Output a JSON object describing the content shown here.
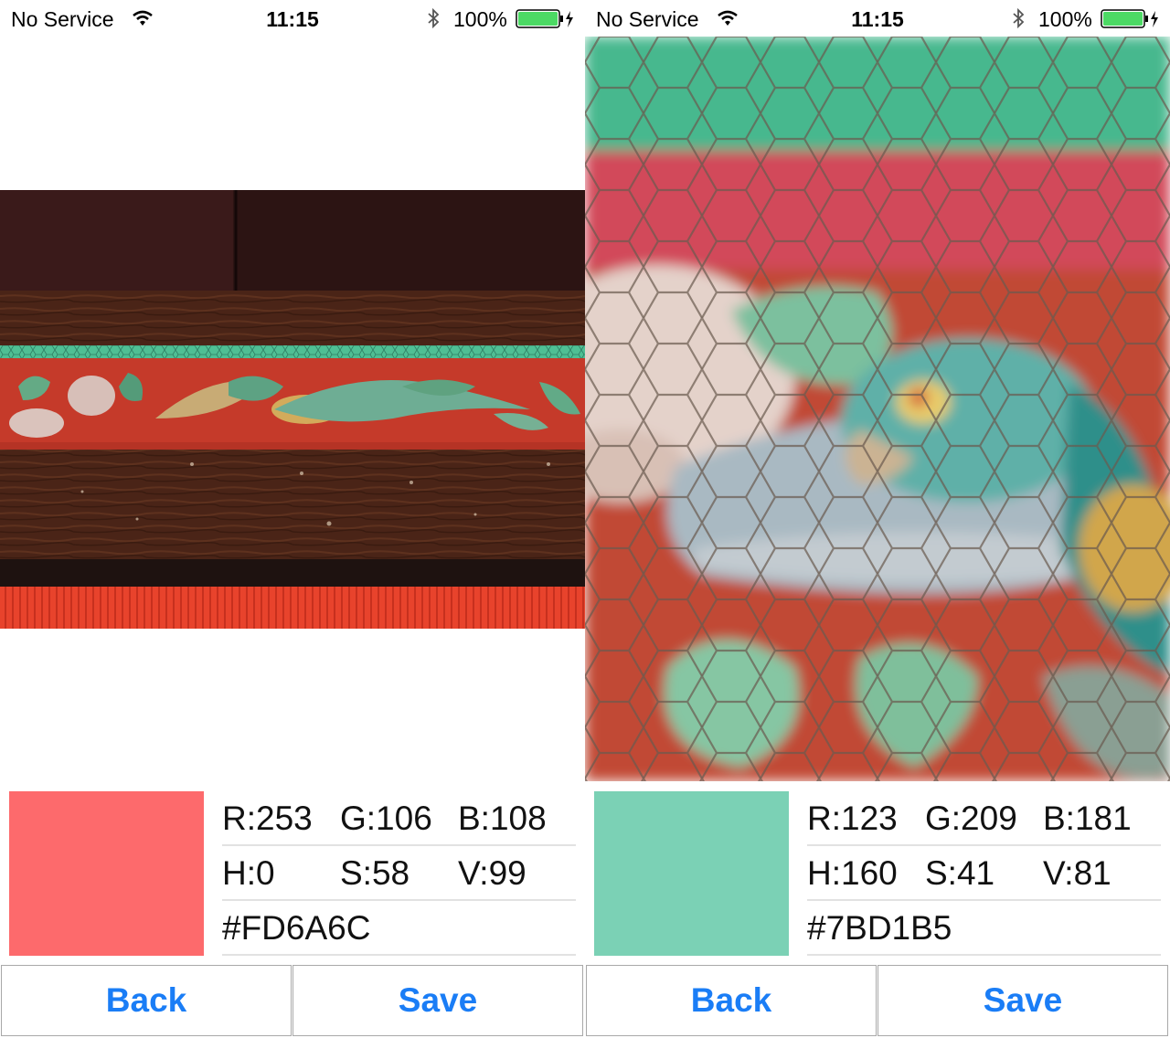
{
  "screens": [
    {
      "status": {
        "carrier": "No Service",
        "time": "11:15",
        "battery": "100%"
      },
      "color": {
        "hex_color": "#FD6A6C",
        "r": "R:253",
        "g": "G:106",
        "b": "B:108",
        "h": "H:0",
        "s": "S:58",
        "v": "V:99",
        "hex": "#FD6A6C"
      },
      "buttons": {
        "back": "Back",
        "save": "Save"
      }
    },
    {
      "status": {
        "carrier": "No Service",
        "time": "11:15",
        "battery": "100%"
      },
      "color": {
        "hex_color": "#7BD1B5",
        "r": "R:123",
        "g": "G:209",
        "b": "B:181",
        "h": "H:160",
        "s": "S:41",
        "v": "V:81",
        "hex": "#7BD1B5"
      },
      "buttons": {
        "back": "Back",
        "save": "Save"
      }
    }
  ],
  "icons": {
    "wifi": "wifi-icon",
    "bluetooth": "bluetooth-icon",
    "battery": "battery-charging-icon"
  },
  "colors": {
    "button_text": "#1a7df6",
    "battery_fill": "#4cd964"
  }
}
